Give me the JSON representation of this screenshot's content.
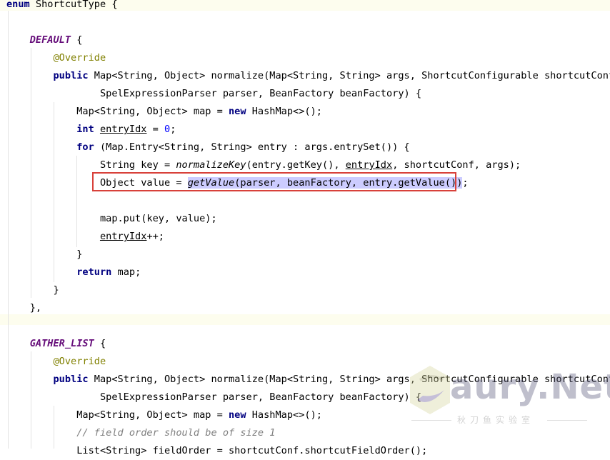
{
  "lines": [
    [
      {
        "t": "enum",
        "c": "kw"
      },
      {
        "t": " ShortcutType {"
      }
    ],
    [],
    [
      {
        "t": "    "
      },
      {
        "t": "DEFAULT",
        "c": "const"
      },
      {
        "t": " {"
      }
    ],
    [
      {
        "t": "        "
      },
      {
        "t": "@Override",
        "c": "ann"
      }
    ],
    [
      {
        "t": "        "
      },
      {
        "t": "public",
        "c": "kw"
      },
      {
        "t": " Map<String, Object> normalize(Map<String, String> args, ShortcutConfigurable shortcutConf,"
      }
    ],
    [
      {
        "t": "                SpelExpressionParser parser, BeanFactory beanFactory) {"
      }
    ],
    [
      {
        "t": "            Map<String, Object> map = "
      },
      {
        "t": "new",
        "c": "kw"
      },
      {
        "t": " HashMap<>();"
      }
    ],
    [
      {
        "t": "            "
      },
      {
        "t": "int",
        "c": "kw"
      },
      {
        "t": " "
      },
      {
        "t": "entryIdx",
        "c": "ul"
      },
      {
        "t": " = "
      },
      {
        "t": "0",
        "c": "num"
      },
      {
        "t": ";"
      }
    ],
    [
      {
        "t": "            "
      },
      {
        "t": "for",
        "c": "kw"
      },
      {
        "t": " (Map.Entry<String, String> entry : args.entrySet()) {"
      }
    ],
    [
      {
        "t": "                String key = "
      },
      {
        "t": "normalizeKey",
        "c": "it"
      },
      {
        "t": "(entry.getKey(), "
      },
      {
        "t": "entryIdx",
        "c": "ul"
      },
      {
        "t": ", shortcutConf, args);"
      }
    ],
    [
      {
        "t": "                Object value = "
      },
      {
        "t": "getValue",
        "c": "it hl"
      },
      {
        "t": "(parser, beanFactory, entry.getValue())",
        "c": "hl"
      },
      {
        "t": ";"
      }
    ],
    [],
    [
      {
        "t": "                map.put(key, value);"
      }
    ],
    [
      {
        "t": "                "
      },
      {
        "t": "entryIdx",
        "c": "ul"
      },
      {
        "t": "++;"
      }
    ],
    [
      {
        "t": "            }"
      }
    ],
    [
      {
        "t": "            "
      },
      {
        "t": "return",
        "c": "kw"
      },
      {
        "t": " map;"
      }
    ],
    [
      {
        "t": "        }"
      }
    ],
    [
      {
        "t": "    },"
      }
    ],
    [],
    [
      {
        "t": "    "
      },
      {
        "t": "GATHER_LIST",
        "c": "const"
      },
      {
        "t": " {"
      }
    ],
    [
      {
        "t": "        "
      },
      {
        "t": "@Override",
        "c": "ann"
      }
    ],
    [
      {
        "t": "        "
      },
      {
        "t": "public",
        "c": "kw"
      },
      {
        "t": " Map<String, Object> normalize(Map<String, String> args, ShortcutConfigurable shortcutConf,"
      }
    ],
    [
      {
        "t": "                SpelExpressionParser parser, BeanFactory beanFactory) {"
      }
    ],
    [
      {
        "t": "            Map<String, Object> map = "
      },
      {
        "t": "new",
        "c": "kw"
      },
      {
        "t": " HashMap<>();"
      }
    ],
    [
      {
        "t": "            "
      },
      {
        "t": "// field order should be of size 1",
        "c": "cm"
      }
    ],
    [
      {
        "t": "            List<String> fieldOrder = shortcutConf.shortcutFieldOrder();"
      }
    ]
  ],
  "watermark": {
    "brand": "aury.Net",
    "subtitle": "秋刀鱼实验室"
  },
  "colors": {
    "keyword": "#000080",
    "enum_constant": "#660e7a",
    "annotation": "#808000",
    "number": "#0000ff",
    "comment": "#808080",
    "selection": "#ccccff",
    "callout_border": "#d8413a",
    "block_band": "#fdfdee"
  }
}
